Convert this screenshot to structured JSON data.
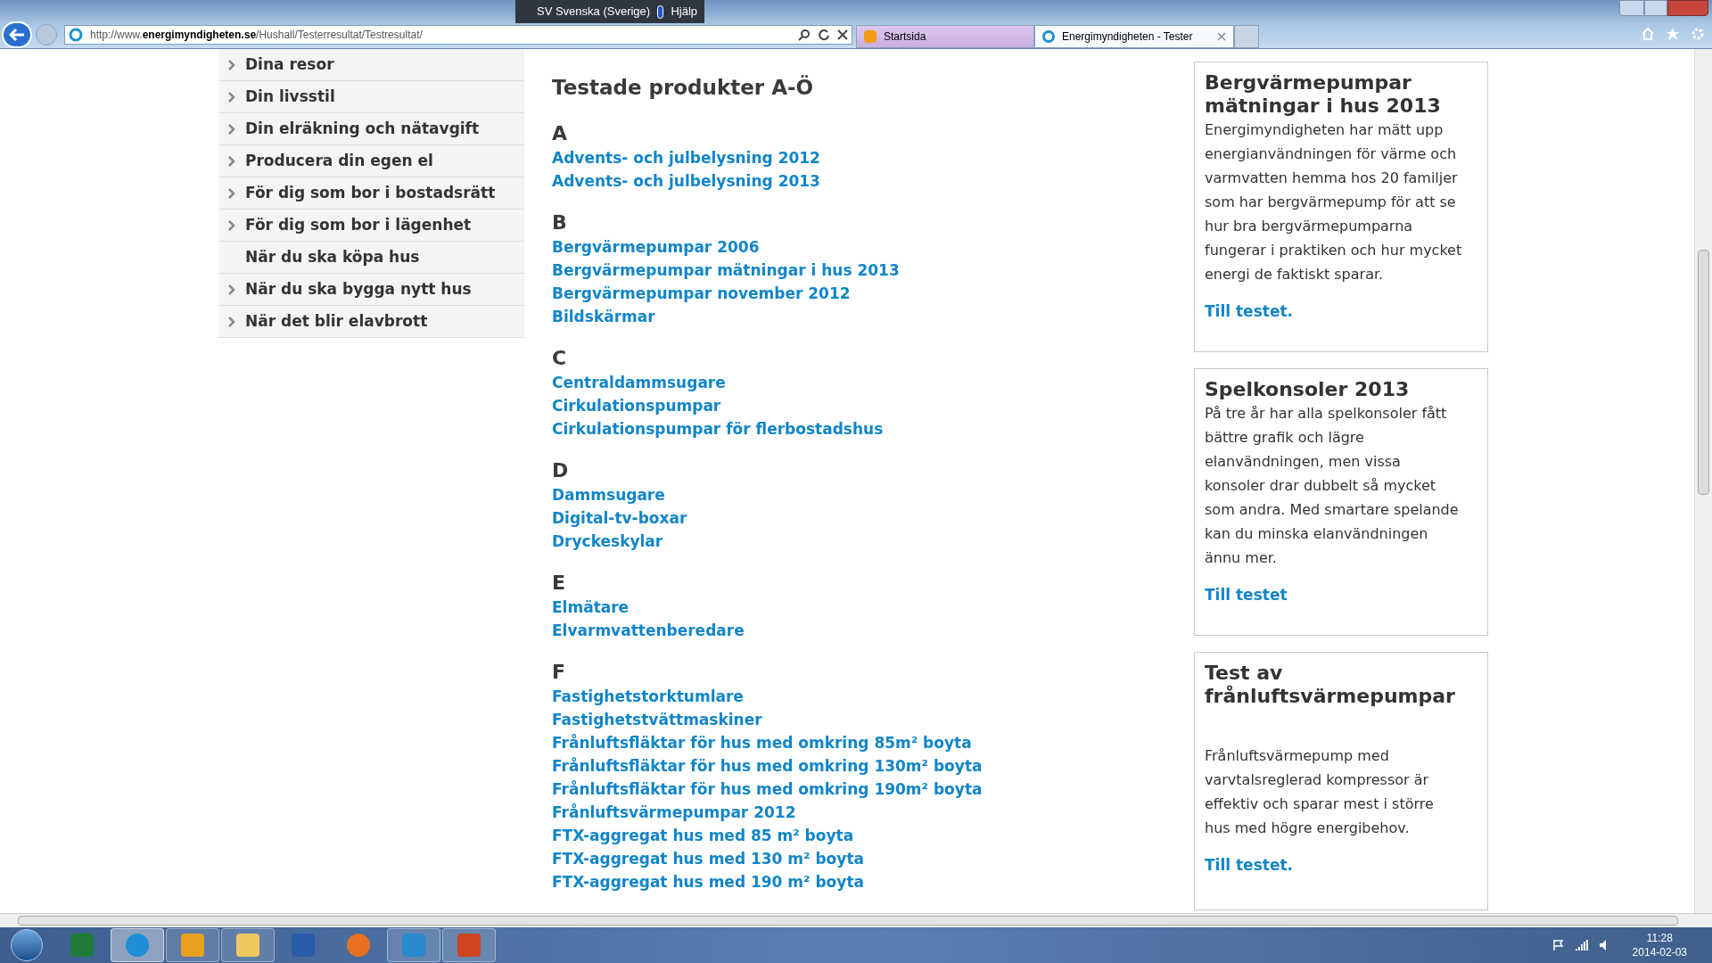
{
  "language_bar": {
    "language": "SV Svenska (Sverige)",
    "help": "Hjälp"
  },
  "address_bar": {
    "url": "http://www.**energimyndigheten.se**/Hushall/Testerresultat/Testresultat/"
  },
  "tabs": [
    {
      "label": "Startsida",
      "selected": false
    },
    {
      "label": "Energimyndigheten - Tester",
      "selected": true
    }
  ],
  "sidebar": {
    "items": [
      {
        "label": "Dina resor",
        "expandable": true
      },
      {
        "label": "Din livsstil",
        "expandable": true
      },
      {
        "label": "Din elräkning och nätavgift",
        "expandable": true
      },
      {
        "label": "Producera din egen el",
        "expandable": true
      },
      {
        "label": "För dig som bor i bostadsrätt",
        "expandable": true
      },
      {
        "label": "För dig som bor i lägenhet",
        "expandable": true
      },
      {
        "label": "När du ska köpa hus",
        "expandable": false
      },
      {
        "label": "När du ska bygga nytt hus",
        "expandable": true
      },
      {
        "label": "När det blir elavbrott",
        "expandable": true
      }
    ]
  },
  "content": {
    "heading": "Testade produkter A-Ö",
    "sections": [
      {
        "letter": "A",
        "links": [
          "Advents- och julbelysning 2012",
          "Advents- och julbelysning 2013"
        ]
      },
      {
        "letter": "B",
        "links": [
          "Bergvärmepumpar 2006",
          "Bergvärmepumpar mätningar i hus 2013",
          "Bergvärmepumpar november 2012",
          "Bildskärmar"
        ]
      },
      {
        "letter": "C",
        "links": [
          "Centraldammsugare",
          "Cirkulationspumpar",
          "Cirkulationspumpar för flerbostadshus"
        ]
      },
      {
        "letter": "D",
        "links": [
          "Dammsugare",
          "Digital-tv-boxar",
          "Dryckeskylar"
        ]
      },
      {
        "letter": "E",
        "links": [
          "Elmätare",
          "Elvarmvattenberedare"
        ]
      },
      {
        "letter": "F",
        "links": [
          "Fastighetstorktumlare",
          "Fastighetstvättmaskiner",
          "Frånluftsfläktar för hus med omkring 85m² boyta",
          "Frånluftsfläktar för hus med omkring 130m² boyta",
          "Frånluftsfläktar för hus med omkring 190m² boyta",
          "Frånluftsvärmepumpar 2012",
          "FTX-aggregat hus med 85 m² boyta",
          "FTX-aggregat hus med 130 m² boyta",
          "FTX-aggregat hus med 190 m² boyta"
        ]
      }
    ]
  },
  "aside": {
    "cards": [
      {
        "title": "Bergvärmepumpar mätningar i hus 2013",
        "body": "Energimyndigheten har mätt upp energianvändningen för värme och varmvatten hemma hos 20 familjer som har bergvärmepump för att se hur bra bergvärmepumparna fungerar i praktiken och hur mycket energi de faktiskt sparar.",
        "link": "Till testet."
      },
      {
        "title": "Spelkonsoler 2013",
        "body": "På tre år har alla spelkonsoler fått bättre grafik och lägre elanvändningen, men vissa konsoler drar dubbelt så mycket som andra. Med smartare spelande kan du minska elanvändningen ännu mer.",
        "link": "Till testet"
      },
      {
        "title": "Test av frånluftsvärmepumpar",
        "body": "Frånluftsvärmepump med varvtalsreglerad kompressor är effektiv och sparar mest i större hus med högre energibehov.",
        "link": "Till testet."
      }
    ]
  },
  "taskbar": {
    "apps": [
      {
        "kind": "spreadsheet",
        "running": false,
        "selected": false
      },
      {
        "kind": "browser",
        "running": true,
        "selected": true
      },
      {
        "kind": "mail",
        "running": true,
        "selected": false
      },
      {
        "kind": "folder",
        "running": true,
        "selected": false
      },
      {
        "kind": "document",
        "running": false,
        "selected": false
      },
      {
        "kind": "media",
        "running": false,
        "selected": false
      },
      {
        "kind": "chat",
        "running": true,
        "selected": false
      },
      {
        "kind": "slides",
        "running": true,
        "selected": false
      }
    ],
    "time": "11:28",
    "date": "2014-02-03"
  }
}
